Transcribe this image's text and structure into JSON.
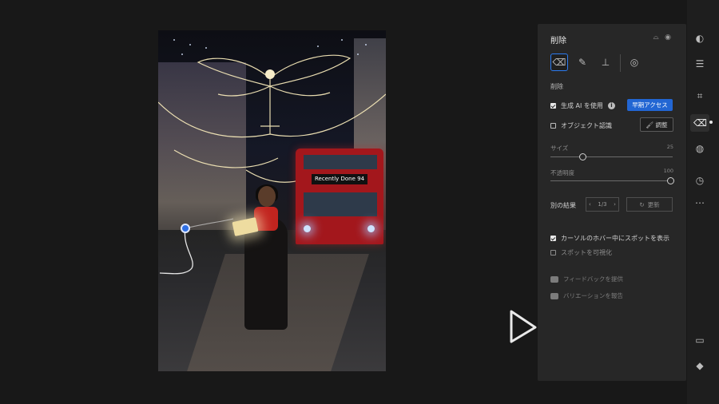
{
  "photo": {
    "bus_sign": "Recently Done  94"
  },
  "panel": {
    "title": "削除",
    "header_icons": [
      "eye-slash-icon",
      "eye-icon"
    ],
    "tools": [
      {
        "name": "eraser-icon",
        "active": true
      },
      {
        "name": "bandage-icon",
        "active": false
      },
      {
        "name": "stamp-icon",
        "active": false
      },
      {
        "name": "eye-dropper-icon",
        "active": false
      }
    ],
    "section_label": "削除",
    "gen_ai_label": "生成 AI を使用",
    "early_access_label": "早期アクセス",
    "object_detect_label": "オブジェクト認識",
    "adjust_label": "調整",
    "size_label": "サイズ",
    "size_value": "25",
    "opacity_label": "不透明度",
    "opacity_value": "100",
    "alt_results_label": "別の結果",
    "pager_value": "1/3",
    "refresh_label": "更新",
    "show_spot_label": "カーソルのホバー中にスポットを表示",
    "visualize_spot_label": "スポットを可視化",
    "feedback_label": "フィードバックを提供",
    "report_label": "バリエーションを報告",
    "accent_color": "#2266d3"
  },
  "rail": {
    "icons": [
      "layers-icon",
      "sliders-icon",
      "crop-icon",
      "eraser-icon",
      "grain-icon",
      "history-icon",
      "more-icon",
      "comment-icon",
      "tag-icon"
    ]
  }
}
